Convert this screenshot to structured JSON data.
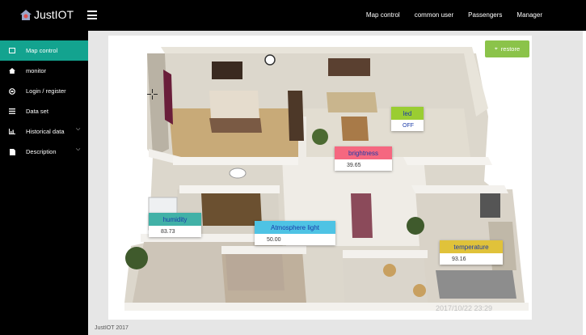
{
  "header": {
    "logo": "JustIOT",
    "nav": [
      "Map control",
      "common user",
      "Passengers",
      "Manager"
    ]
  },
  "sidebar": {
    "items": [
      {
        "label": "Map control",
        "icon": "map-icon",
        "active": true
      },
      {
        "label": "monitor",
        "icon": "home-icon"
      },
      {
        "label": "Login / register",
        "icon": "login-icon"
      },
      {
        "label": "Data set",
        "icon": "list-icon"
      },
      {
        "label": "Historical data",
        "icon": "chart-icon",
        "expandable": true
      },
      {
        "label": "Description",
        "icon": "document-icon",
        "expandable": true
      }
    ]
  },
  "map": {
    "restore_label": "restore",
    "timestamp": "2017/10/22 23:29",
    "sensors": {
      "led": {
        "label": "led",
        "value": "OFF",
        "color": "#9acd32"
      },
      "brightness": {
        "label": "brightness",
        "value": "39.65",
        "color": "#f56780"
      },
      "humidity": {
        "label": "humidity",
        "value": "83.73",
        "color": "#41b1a7"
      },
      "atmosphere": {
        "label": "Atmosphere light",
        "value": "50.00",
        "color": "#4ec3e4"
      },
      "temperature": {
        "label": "temperature",
        "value": "93.16",
        "color": "#e0c23a"
      }
    }
  },
  "footer": {
    "text": "JustIOT 2017"
  },
  "colors": {
    "accent": "#13a38f",
    "restore": "#8bc34a",
    "header": "#000000"
  }
}
